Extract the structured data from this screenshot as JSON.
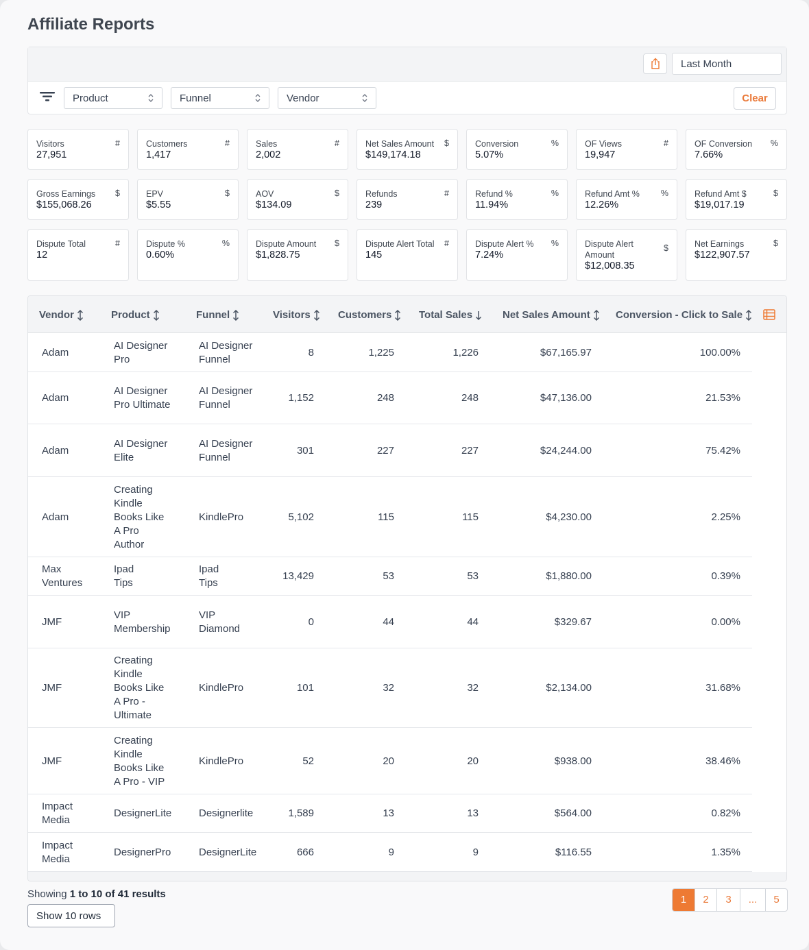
{
  "page": {
    "title": "Affiliate Reports"
  },
  "filters": {
    "date_range": "Last Month",
    "product": "Product",
    "funnel": "Funnel",
    "vendor": "Vendor",
    "clear_label": "Clear"
  },
  "stats": [
    {
      "label": "Visitors",
      "unit": "#",
      "value": "27,951"
    },
    {
      "label": "Customers",
      "unit": "#",
      "value": "1,417"
    },
    {
      "label": "Sales",
      "unit": "#",
      "value": "2,002"
    },
    {
      "label": "Net Sales Amount",
      "unit": "$",
      "value": "$149,174.18"
    },
    {
      "label": "Conversion",
      "unit": "%",
      "value": "5.07%"
    },
    {
      "label": "OF Views",
      "unit": "#",
      "value": "19,947"
    },
    {
      "label": "OF Conversion",
      "unit": "%",
      "value": "7.66%"
    },
    {
      "label": "Gross Earnings",
      "unit": "$",
      "value": "$155,068.26"
    },
    {
      "label": "EPV",
      "unit": "$",
      "value": "$5.55"
    },
    {
      "label": "AOV",
      "unit": "$",
      "value": "$134.09"
    },
    {
      "label": "Refunds",
      "unit": "#",
      "value": "239"
    },
    {
      "label": "Refund %",
      "unit": "%",
      "value": "11.94%"
    },
    {
      "label": "Refund Amt %",
      "unit": "%",
      "value": "12.26%"
    },
    {
      "label": "Refund Amt $",
      "unit": "$",
      "value": "$19,017.19"
    },
    {
      "label": "Dispute Total",
      "unit": "#",
      "value": "12"
    },
    {
      "label": "Dispute %",
      "unit": "%",
      "value": "0.60%"
    },
    {
      "label": "Dispute Amount",
      "unit": "$",
      "value": "$1,828.75"
    },
    {
      "label": "Dispute Alert Total",
      "unit": "#",
      "value": "145"
    },
    {
      "label": "Dispute Alert %",
      "unit": "%",
      "value": "7.24%"
    },
    {
      "label": "Dispute Alert Amount",
      "unit": "$",
      "value": "$12,008.35"
    },
    {
      "label": "Net Earnings",
      "unit": "$",
      "value": "$122,907.57"
    }
  ],
  "table": {
    "columns": [
      "Vendor",
      "Product",
      "Funnel",
      "Visitors",
      "Customers",
      "Total Sales",
      "Net Sales Amount",
      "Conversion - Click to Sale"
    ],
    "rows": [
      {
        "vendor": "Adam",
        "product": "AI Designer\nPro",
        "funnel": "AI Designer\nFunnel",
        "visitors": "8",
        "customers": "1,225",
        "total_sales": "1,226",
        "net_sales": "$67,165.97",
        "conversion": "100.00%"
      },
      {
        "vendor": "Adam",
        "product": "AI Designer\nPro Ultimate",
        "funnel": "AI Designer\nFunnel",
        "visitors": "1,152",
        "customers": "248",
        "total_sales": "248",
        "net_sales": "$47,136.00",
        "conversion": "21.53%"
      },
      {
        "vendor": "Adam",
        "product": "AI Designer\nElite",
        "funnel": "AI Designer\nFunnel",
        "visitors": "301",
        "customers": "227",
        "total_sales": "227",
        "net_sales": "$24,244.00",
        "conversion": "75.42%"
      },
      {
        "vendor": "Adam",
        "product": "Creating\nKindle\nBooks Like\nA Pro\nAuthor",
        "funnel": "KindlePro",
        "visitors": "5,102",
        "customers": "115",
        "total_sales": "115",
        "net_sales": "$4,230.00",
        "conversion": "2.25%"
      },
      {
        "vendor": "Max\nVentures",
        "product": "Ipad\nTips",
        "funnel": "Ipad\nTips",
        "visitors": "13,429",
        "customers": "53",
        "total_sales": "53",
        "net_sales": "$1,880.00",
        "conversion": "0.39%"
      },
      {
        "vendor": "JMF",
        "product": "VIP\nMembership",
        "funnel": "VIP\nDiamond",
        "visitors": "0",
        "customers": "44",
        "total_sales": "44",
        "net_sales": "$329.67",
        "conversion": "0.00%"
      },
      {
        "vendor": "JMF",
        "product": "Creating\nKindle\nBooks Like\nA Pro -\nUltimate",
        "funnel": "KindlePro",
        "visitors": "101",
        "customers": "32",
        "total_sales": "32",
        "net_sales": "$2,134.00",
        "conversion": "31.68%"
      },
      {
        "vendor": "JMF",
        "product": "Creating\nKindle\nBooks Like\nA Pro - VIP",
        "funnel": "KindlePro",
        "visitors": "52",
        "customers": "20",
        "total_sales": "20",
        "net_sales": "$938.00",
        "conversion": "38.46%"
      },
      {
        "vendor": "Impact\nMedia",
        "product": "DesignerLite",
        "funnel": "Designerlite",
        "visitors": "1,589",
        "customers": "13",
        "total_sales": "13",
        "net_sales": "$564.00",
        "conversion": "0.82%"
      },
      {
        "vendor": "Impact\nMedia",
        "product": "DesignerPro",
        "funnel": "DesignerLite",
        "visitors": "666",
        "customers": "9",
        "total_sales": "9",
        "net_sales": "$116.55",
        "conversion": "1.35%"
      }
    ]
  },
  "footer": {
    "showing_prefix": "Showing",
    "showing_range": "1 to 10 of 41 results",
    "rows_button": "Show 10 rows",
    "pages": [
      "1",
      "2",
      "3",
      "...",
      "5"
    ],
    "active_page": "1"
  },
  "colors": {
    "accent": "#ee7a33",
    "header_bg": "#f3f4f6",
    "border": "#e1e3e6"
  },
  "icons": {
    "share": "share-icon",
    "filter": "filter-icon",
    "columns": "columns-icon",
    "sort": "sort-icon",
    "sort_desc": "arrow-down-icon"
  }
}
